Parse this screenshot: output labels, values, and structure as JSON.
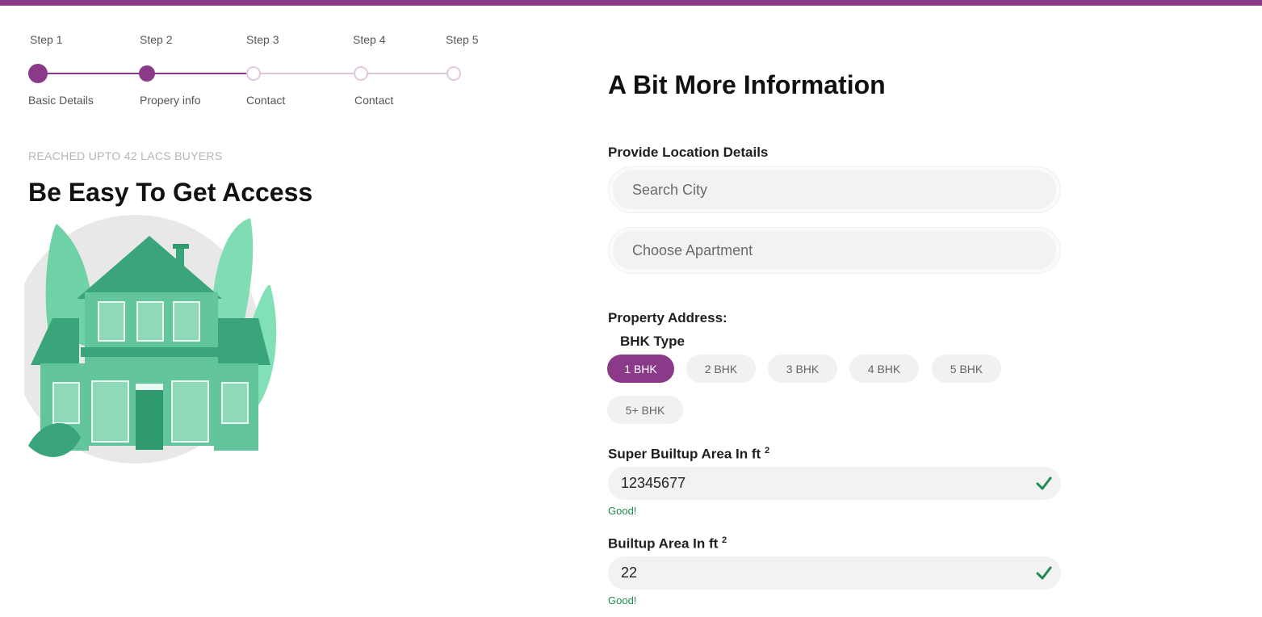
{
  "stepper": {
    "steps": [
      {
        "title": "Step 1",
        "label": "Basic Details",
        "state": "done"
      },
      {
        "title": "Step 2",
        "label": "Propery info",
        "state": "done"
      },
      {
        "title": "Step 3",
        "label": "Contact",
        "state": "pending"
      },
      {
        "title": "Step 4",
        "label": "Contact",
        "state": "pending"
      },
      {
        "title": "Step 5",
        "label": "",
        "state": "pending"
      }
    ]
  },
  "left": {
    "eyebrow": "REACHED UPTO 42 LACS BUYERS",
    "headline": "Be Easy To Get Access"
  },
  "form": {
    "title": "A Bit More Information",
    "location_label": "Provide Location Details",
    "city_placeholder": "Search City",
    "apartment_placeholder": "Choose Apartment",
    "property_address_label": "Property Address:",
    "bhk_label": "BHK Type",
    "bhk_options": [
      "1 BHK",
      "2 BHK",
      "3 BHK",
      "4 BHK",
      "5 BHK",
      "5+ BHK"
    ],
    "bhk_selected": "1 BHK",
    "super_area_label": "Super Builtup Area In ft",
    "super_area_sup": "2",
    "super_area_value": "12345677",
    "super_area_status": "Good!",
    "builtup_label": "Builtup Area In ft",
    "builtup_sup": "2",
    "builtup_value": "22",
    "builtup_status": "Good!"
  },
  "colors": {
    "accent": "#8a3a88",
    "accent_light": "#e2c7e1",
    "success": "#1e8a4f",
    "house_green": "#5fc59a"
  }
}
